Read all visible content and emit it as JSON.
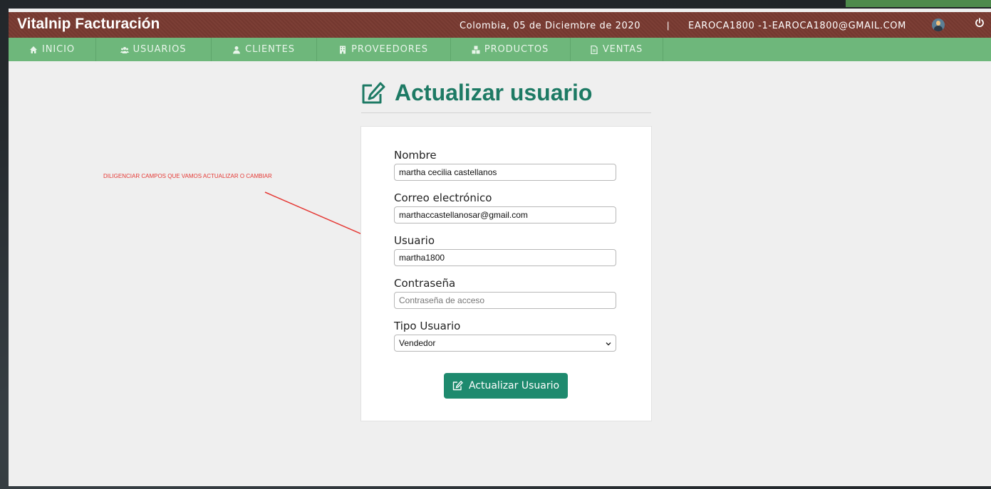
{
  "app": {
    "brand": "Vitalnip Facturación",
    "date": "Colombia, 05 de Diciembre de 2020",
    "separator": "|",
    "user": "EAROCA1800 -1-EAROCA1800@GMAIL.COM",
    "avatar_icon": "user-avatar-icon",
    "power_icon": "power-icon"
  },
  "nav": {
    "items": [
      {
        "label": "INICIO",
        "icon": "home-icon"
      },
      {
        "label": "USUARIOS",
        "icon": "users-icon"
      },
      {
        "label": "CLIENTES",
        "icon": "user-icon"
      },
      {
        "label": "PROVEEDORES",
        "icon": "building-icon"
      },
      {
        "label": "PRODUCTOS",
        "icon": "cubes-icon"
      },
      {
        "label": "VENTAS",
        "icon": "file-icon"
      }
    ]
  },
  "page": {
    "title": "Actualizar usuario",
    "title_icon": "edit-icon"
  },
  "form": {
    "nombre_label": "Nombre",
    "nombre_value": "martha cecilia castellanos",
    "correo_label": "Correo electrónico",
    "correo_value": "marthaccastellanosar@gmail.com",
    "usuario_label": "Usuario",
    "usuario_value": "martha1800",
    "contrasena_label": "Contraseña",
    "contrasena_placeholder": "Contraseña de acceso",
    "tipo_label": "Tipo Usuario",
    "tipo_value": "Vendedor",
    "submit_label": "Actualizar Usuario"
  },
  "annotation": {
    "text": "DILIGENCIAR CAMPOS QUE VAMOS ACTUALIZAR O CAMBIAR"
  },
  "colors": {
    "header": "#7a3b32",
    "navbar": "#6eb77b",
    "accent": "#1d7a64",
    "button": "#1e8a6e",
    "annotation": "#e53935"
  }
}
